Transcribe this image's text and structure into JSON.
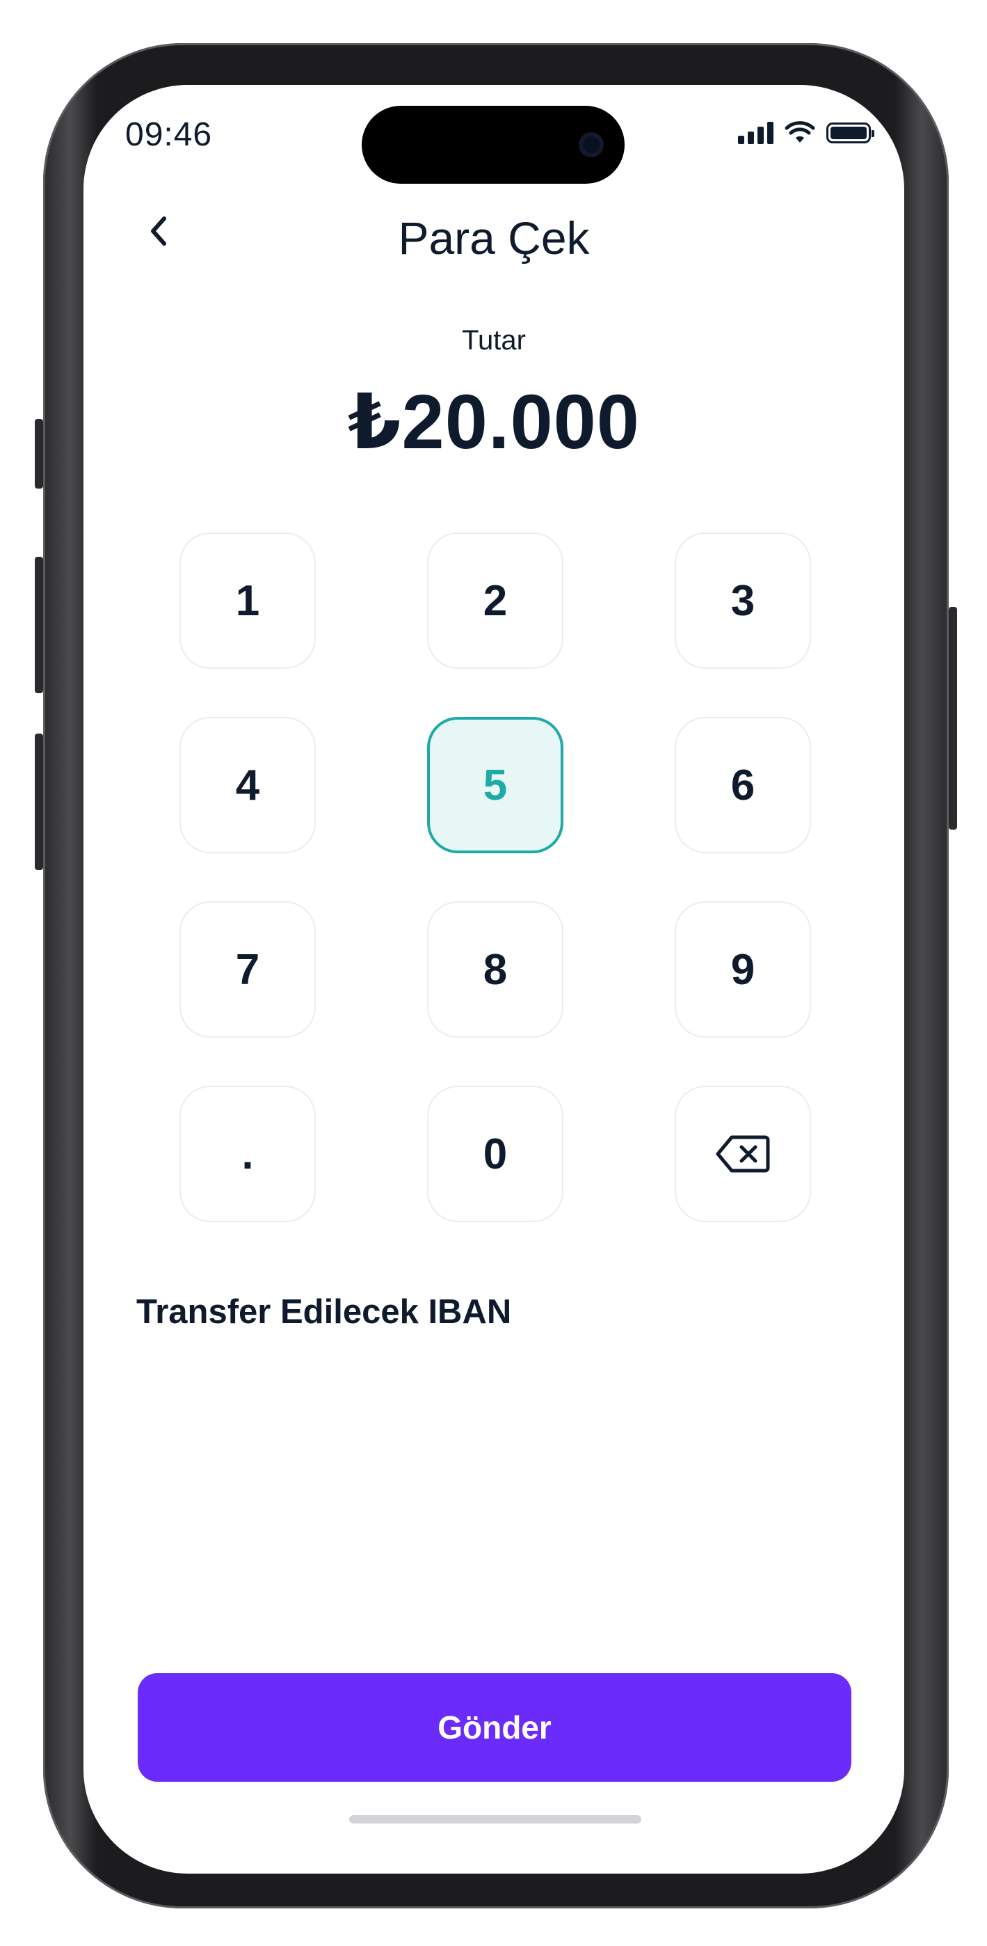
{
  "status_bar": {
    "time": "09:46"
  },
  "header": {
    "title": "Para Çek"
  },
  "amount": {
    "label": "Tutar",
    "value": "₺20.000"
  },
  "keypad": {
    "keys": [
      {
        "label": "1",
        "active": false
      },
      {
        "label": "2",
        "active": false
      },
      {
        "label": "3",
        "active": false
      },
      {
        "label": "4",
        "active": false
      },
      {
        "label": "5",
        "active": true
      },
      {
        "label": "6",
        "active": false
      },
      {
        "label": "7",
        "active": false
      },
      {
        "label": "8",
        "active": false
      },
      {
        "label": "9",
        "active": false
      },
      {
        "label": ".",
        "active": false
      },
      {
        "label": "0",
        "active": false
      },
      {
        "label": "",
        "icon": "backspace-icon",
        "active": false
      }
    ],
    "active_color": "#20aaa6"
  },
  "iban": {
    "label": "Transfer Edilecek IBAN"
  },
  "actions": {
    "send_label": "Gönder",
    "send_color": "#6b2bfa"
  }
}
